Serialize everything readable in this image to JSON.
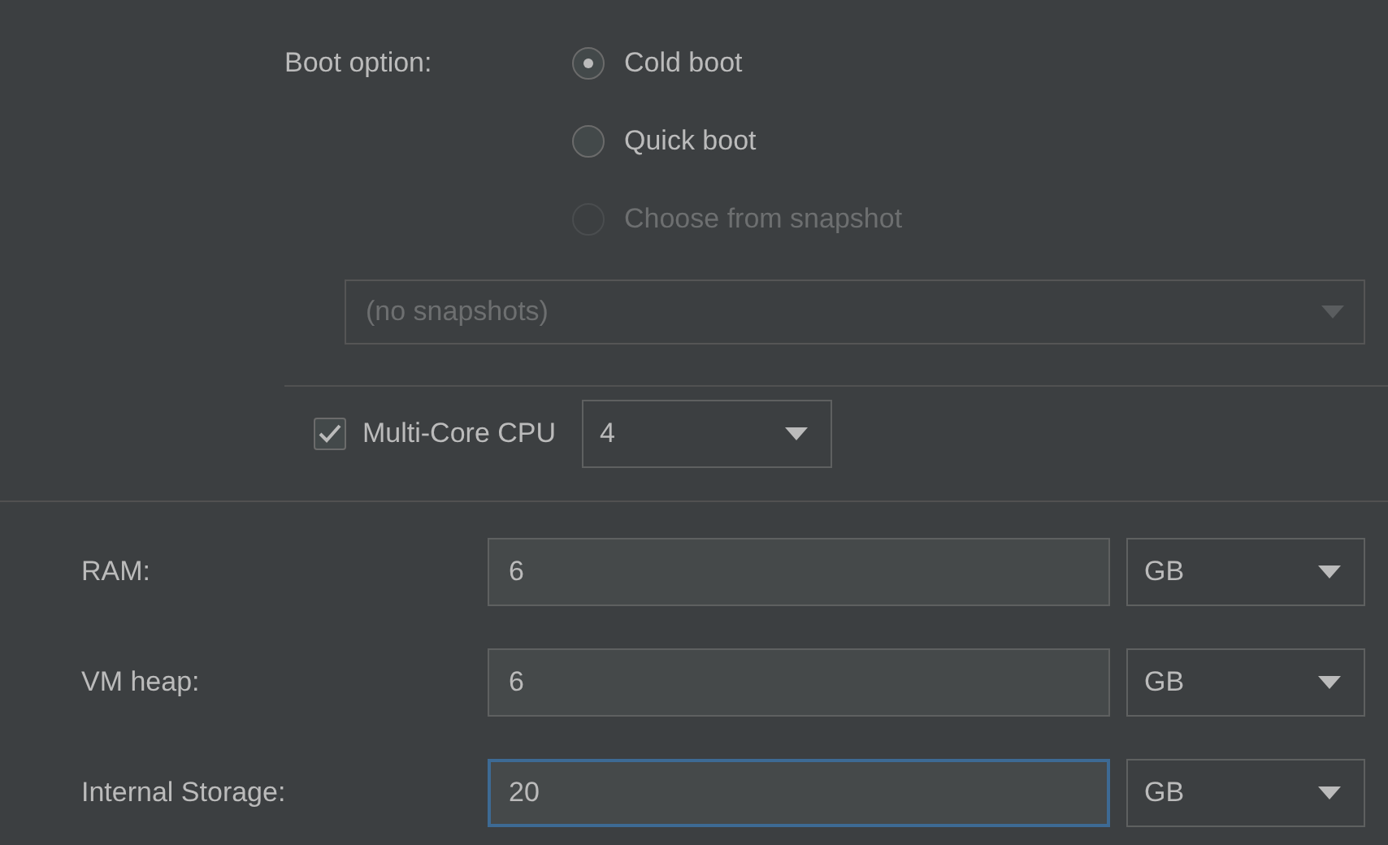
{
  "boot_option": {
    "label": "Boot option:",
    "options": [
      {
        "label": "Cold boot",
        "selected": true,
        "disabled": false
      },
      {
        "label": "Quick boot",
        "selected": false,
        "disabled": false
      },
      {
        "label": "Choose from snapshot",
        "selected": false,
        "disabled": true
      }
    ]
  },
  "snapshot_dropdown": {
    "value": "(no snapshots)",
    "disabled": true
  },
  "multi_core": {
    "label": "Multi-Core CPU",
    "checked": true,
    "value": "4"
  },
  "fields": [
    {
      "label": "RAM:",
      "value": "6",
      "unit": "GB",
      "focused": false
    },
    {
      "label": "VM heap:",
      "value": "6",
      "unit": "GB",
      "focused": false
    },
    {
      "label": "Internal Storage:",
      "value": "20",
      "unit": "GB",
      "focused": true
    }
  ]
}
